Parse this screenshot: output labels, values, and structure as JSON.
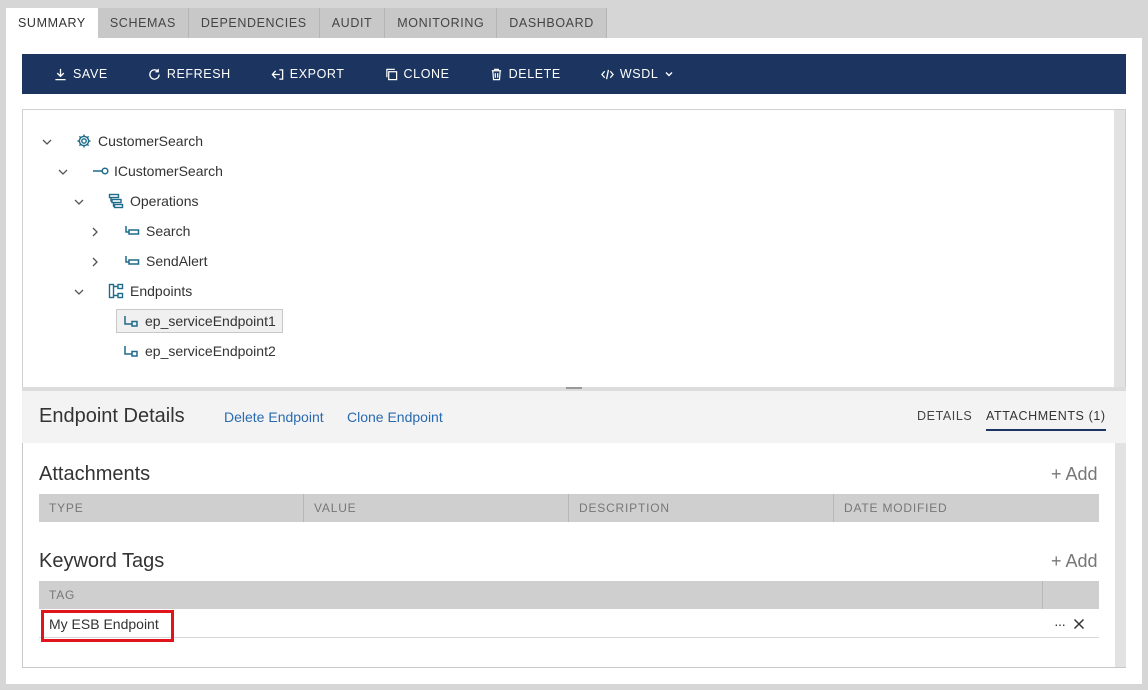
{
  "tabs": [
    {
      "label": "SUMMARY",
      "active": true
    },
    {
      "label": "SCHEMAS",
      "active": false
    },
    {
      "label": "DEPENDENCIES",
      "active": false
    },
    {
      "label": "AUDIT",
      "active": false
    },
    {
      "label": "MONITORING",
      "active": false
    },
    {
      "label": "DASHBOARD",
      "active": false
    }
  ],
  "toolbar": {
    "save": "SAVE",
    "refresh": "REFRESH",
    "export": "EXPORT",
    "clone": "CLONE",
    "delete": "DELETE",
    "wsdl": "WSDL"
  },
  "tree": {
    "root": "CustomerSearch",
    "interface": "ICustomerSearch",
    "operations": "Operations",
    "op1": "Search",
    "op2": "SendAlert",
    "endpoints": "Endpoints",
    "ep1": "ep_serviceEndpoint1",
    "ep2": "ep_serviceEndpoint2"
  },
  "details": {
    "title": "Endpoint Details",
    "delete_link": "Delete Endpoint",
    "clone_link": "Clone Endpoint",
    "tab_details": "DETAILS",
    "tab_attachments": "ATTACHMENTS (1)"
  },
  "attachments": {
    "title": "Attachments",
    "add": "+ Add",
    "columns": [
      "TYPE",
      "VALUE",
      "DESCRIPTION",
      "DATE MODIFIED"
    ]
  },
  "keywords": {
    "title": "Keyword Tags",
    "add": "+ Add",
    "column": "TAG",
    "rows": [
      "My ESB Endpoint"
    ],
    "more": "···"
  },
  "colors": {
    "toolbar_bg": "#1b3560",
    "link": "#2a6bb0",
    "highlight": "#e0141b"
  }
}
